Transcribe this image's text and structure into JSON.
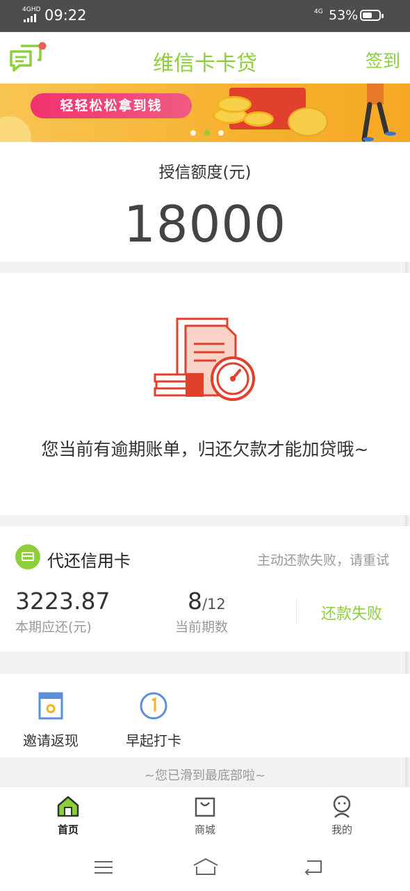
{
  "status_bar": {
    "network_top": "4GHD",
    "time": "09:22",
    "network_right": "4G",
    "battery": "53%"
  },
  "header": {
    "title": "维信卡卡贷",
    "signin": "签到",
    "message_icon": "chat-bubble-icon"
  },
  "banner": {
    "slogan": "轻轻松松拿到钱",
    "slide_count": 3,
    "active_slide": 1
  },
  "credit": {
    "label": "授信额度(元)",
    "amount": "18000"
  },
  "overdue": {
    "message": "您当前有逾期账单，归还欠款才能加贷哦~",
    "illustration": "overdue-bill-icon"
  },
  "loan": {
    "title": "代还信用卡",
    "hint": "主动还款失败，请重试",
    "amount": "3223.87",
    "amount_label": "本期应还(元)",
    "period_current": "8",
    "period_total": "/12",
    "period_label": "当前期数",
    "status": "还款失败"
  },
  "actions": [
    {
      "label": "邀请返现",
      "icon": "gift-box-icon"
    },
    {
      "label": "早起打卡",
      "icon": "clock-badge-icon"
    }
  ],
  "footer_note": "~您已滑到最底部啦~",
  "tabbar": [
    {
      "label": "首页",
      "icon": "home-icon",
      "active": true
    },
    {
      "label": "商城",
      "icon": "shopping-bag-icon",
      "active": false
    },
    {
      "label": "我的",
      "icon": "person-icon",
      "active": false
    }
  ],
  "colors": {
    "accent": "#8ccf3a",
    "alert_red": "#e0402c",
    "status_bar": "#4d4d4d"
  }
}
